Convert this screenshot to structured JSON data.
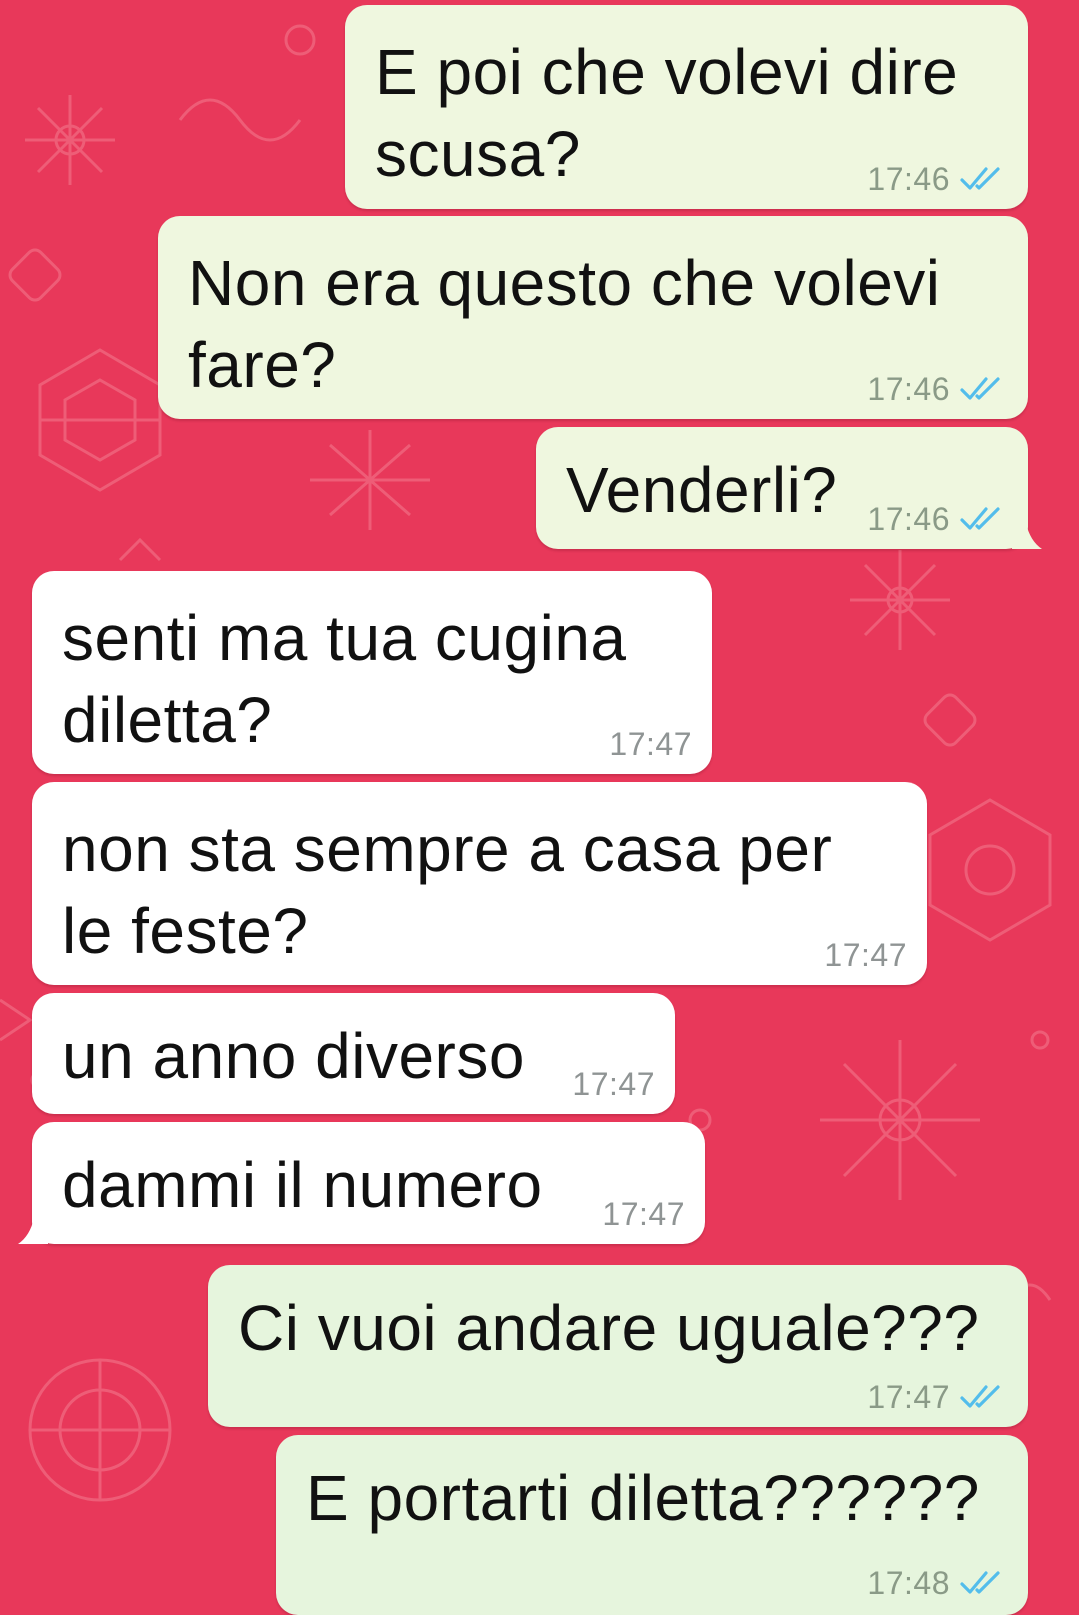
{
  "theme": {
    "wallpaper_color": "#e8385a",
    "wallpaper_doodle_color": "#f06a82",
    "outgoing_bubble_color": "#eff7df",
    "incoming_bubble_color": "#ffffff",
    "read_tick_color": "#53bdeb"
  },
  "messages": [
    {
      "direction": "outgoing",
      "text": "E poi che volevi dire\nscusa?",
      "time": "17:46",
      "status": "read"
    },
    {
      "direction": "outgoing",
      "text": "Non era questo che volevi\nfare?",
      "time": "17:46",
      "status": "read"
    },
    {
      "direction": "outgoing",
      "text": "Venderli?",
      "time": "17:46",
      "status": "read"
    },
    {
      "direction": "incoming",
      "text": "senti ma tua cugina\ndiletta?",
      "time": "17:47"
    },
    {
      "direction": "incoming",
      "text": "non sta sempre a casa per\nle feste?",
      "time": "17:47"
    },
    {
      "direction": "incoming",
      "text": "un anno diverso",
      "time": "17:47"
    },
    {
      "direction": "incoming",
      "text": "dammi il numero",
      "time": "17:47"
    },
    {
      "direction": "outgoing",
      "text": "Ci vuoi andare uguale???",
      "time": "17:47",
      "status": "read"
    },
    {
      "direction": "outgoing",
      "text": "E portarti diletta??????",
      "time": "17:48",
      "status": "read"
    }
  ]
}
